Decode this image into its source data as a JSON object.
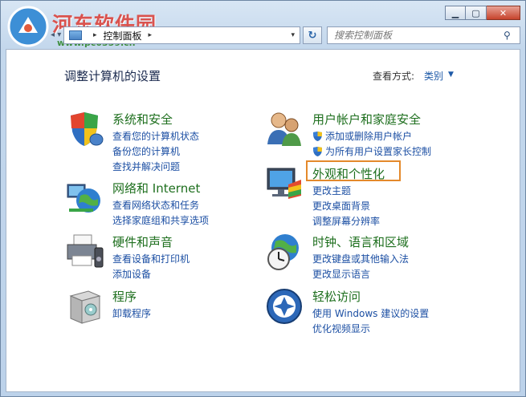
{
  "watermark": {
    "title": "河东软件园",
    "url": "www.pc0359.cn"
  },
  "window": {
    "minimize": "▁",
    "maximize": "▢",
    "close": "✕"
  },
  "nav": {
    "arrows": "◂ ▾"
  },
  "address": {
    "path": "控制面板",
    "separator": "▸",
    "dropdown": "▾",
    "refresh": "↻"
  },
  "search": {
    "placeholder": "搜索控制面板",
    "icon": "⚲"
  },
  "page": {
    "title": "调整计算机的设置",
    "view_label": "查看方式:",
    "view_value": "类别",
    "view_arrow": "▼"
  },
  "categories": [
    {
      "name": "system-security",
      "title": "系统和安全",
      "icon": "shield-icon",
      "links": [
        "查看您的计算机状态",
        "备份您的计算机",
        "查找并解决问题"
      ]
    },
    {
      "name": "network-internet",
      "title": "网络和 Internet",
      "icon": "network-globe-icon",
      "links": [
        "查看网络状态和任务",
        "选择家庭组和共享选项"
      ]
    },
    {
      "name": "hardware-sound",
      "title": "硬件和声音",
      "icon": "printer-icon",
      "links": [
        "查看设备和打印机",
        "添加设备"
      ]
    },
    {
      "name": "programs",
      "title": "程序",
      "icon": "programs-box-icon",
      "links": [
        "卸载程序"
      ]
    },
    {
      "name": "user-accounts",
      "title": "用户帐户和家庭安全",
      "icon": "users-icon",
      "links": [
        "添加或删除用户帐户",
        "为所有用户设置家长控制"
      ]
    },
    {
      "name": "appearance",
      "title": "外观和个性化",
      "icon": "monitor-palette-icon",
      "links": [
        "更改主题",
        "更改桌面背景",
        "调整屏幕分辨率"
      ]
    },
    {
      "name": "clock-language",
      "title": "时钟、语言和区域",
      "icon": "clock-globe-icon",
      "links": [
        "更改键盘或其他输入法",
        "更改显示语言"
      ]
    },
    {
      "name": "ease-of-access",
      "title": "轻松访问",
      "icon": "ease-access-icon",
      "links": [
        "使用 Windows 建议的设置",
        "优化视频显示"
      ]
    }
  ],
  "colors": {
    "heading_green": "#1e6f1e",
    "link_blue": "#1c4fa3",
    "highlight_orange": "#e4892b"
  }
}
